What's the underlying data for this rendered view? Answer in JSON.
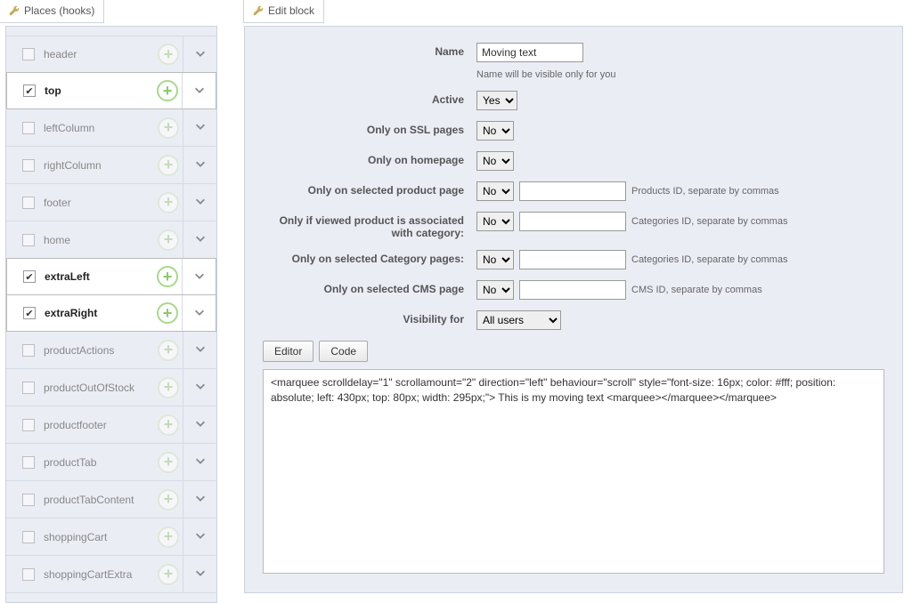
{
  "sidebar": {
    "title": "Places (hooks)",
    "hooks": [
      {
        "label": "header",
        "checked": false
      },
      {
        "label": "top",
        "checked": true
      },
      {
        "label": "leftColumn",
        "checked": false
      },
      {
        "label": "rightColumn",
        "checked": false
      },
      {
        "label": "footer",
        "checked": false
      },
      {
        "label": "home",
        "checked": false
      },
      {
        "label": "extraLeft",
        "checked": true
      },
      {
        "label": "extraRight",
        "checked": true
      },
      {
        "label": "productActions",
        "checked": false
      },
      {
        "label": "productOutOfStock",
        "checked": false
      },
      {
        "label": "productfooter",
        "checked": false
      },
      {
        "label": "productTab",
        "checked": false
      },
      {
        "label": "productTabContent",
        "checked": false
      },
      {
        "label": "shoppingCart",
        "checked": false
      },
      {
        "label": "shoppingCartExtra",
        "checked": false
      }
    ]
  },
  "edit": {
    "title": "Edit block",
    "fields": {
      "name_label": "Name",
      "name_value": "Moving text",
      "name_hint": "Name will be visible only for you",
      "active_label": "Active",
      "active_value": "Yes",
      "ssl_label": "Only on SSL pages",
      "ssl_value": "No",
      "home_label": "Only on homepage",
      "home_value": "No",
      "product_label": "Only on selected product page",
      "product_value": "No",
      "product_ids": "",
      "product_hint": "Products ID, separate by commas",
      "assoc_label": "Only if viewed product is associated with category:",
      "assoc_value": "No",
      "assoc_ids": "",
      "assoc_hint": "Categories ID, separate by commas",
      "cat_label": "Only on selected Category pages:",
      "cat_value": "No",
      "cat_ids": "",
      "cat_hint": "Categories ID, separate by commas",
      "cms_label": "Only on selected CMS page",
      "cms_value": "No",
      "cms_ids": "",
      "cms_hint": "CMS ID, separate by commas",
      "visibility_label": "Visibility for",
      "visibility_value": "All users"
    },
    "tabs": {
      "editor": "Editor",
      "code": "Code"
    },
    "code": "<marquee scrolldelay=\"1\" scrollamount=\"2\" direction=\"left\" behaviour=\"scroll\" style=\"font-size: 16px; color: #fff; position: absolute; left: 430px; top: 80px; width: 295px;\"> This is my moving text <marquee></marquee></marquee>"
  }
}
